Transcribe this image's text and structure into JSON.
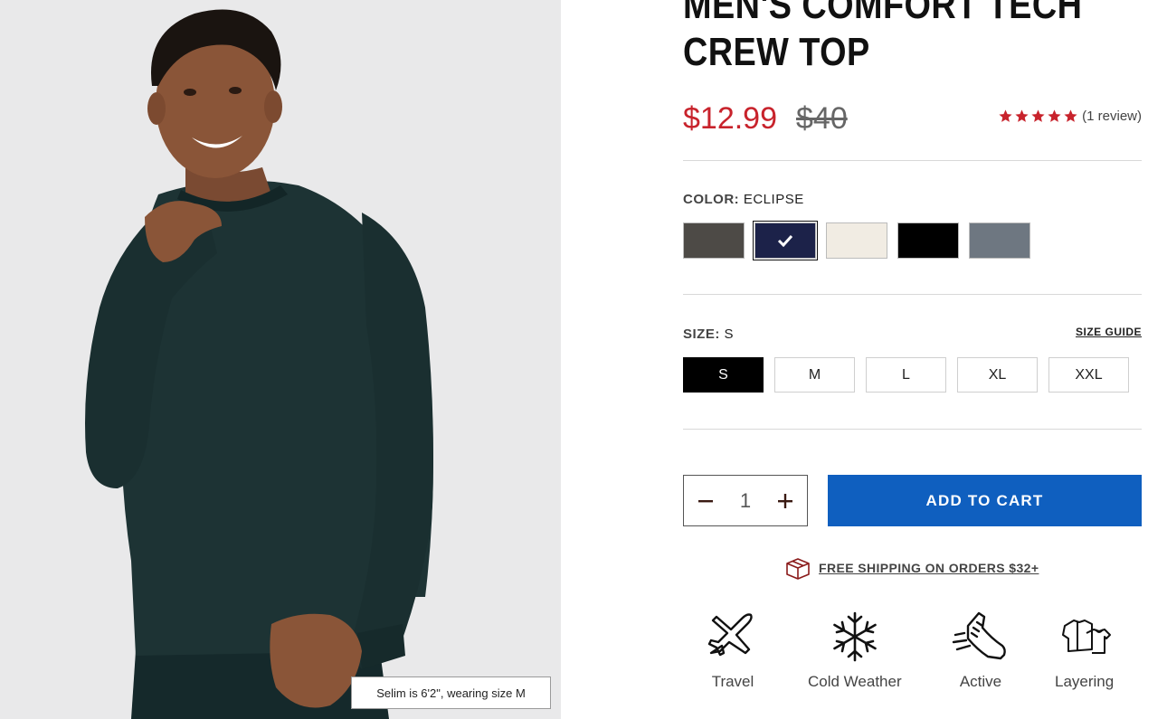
{
  "product": {
    "title": "Men's Comfort Tech Crew Top",
    "sale_price": "$12.99",
    "original_price": "$40",
    "review_count_text": "(1 review)",
    "rating": 5,
    "rating_max": 5
  },
  "photo": {
    "caption": "Selim is 6'2\", wearing size M"
  },
  "color": {
    "label": "COLOR:",
    "selected": "ECLIPSE",
    "swatches": [
      {
        "hex": "#4d4a46"
      },
      {
        "hex": "#1c2249",
        "selected": true
      },
      {
        "hex": "#f1ece3"
      },
      {
        "hex": "#000000"
      },
      {
        "hex": "#6e7781"
      }
    ]
  },
  "size": {
    "label": "SIZE:",
    "selected": "S",
    "guide_link": "SIZE GUIDE",
    "options": [
      "S",
      "M",
      "L",
      "XL",
      "XXL"
    ]
  },
  "cart": {
    "quantity": "1",
    "add_label": "ADD TO CART"
  },
  "shipping": {
    "text": "FREE SHIPPING ON ORDERS $32+"
  },
  "features": [
    {
      "label": "Travel",
      "icon": "airplane-icon"
    },
    {
      "label": "Cold Weather",
      "icon": "snowflake-icon"
    },
    {
      "label": "Active",
      "icon": "sneaker-icon"
    },
    {
      "label": "Layering",
      "icon": "layering-icon"
    }
  ],
  "colors": {
    "sale": "#c8232c",
    "cta": "#0f5fbf",
    "star": "#c8232c"
  }
}
